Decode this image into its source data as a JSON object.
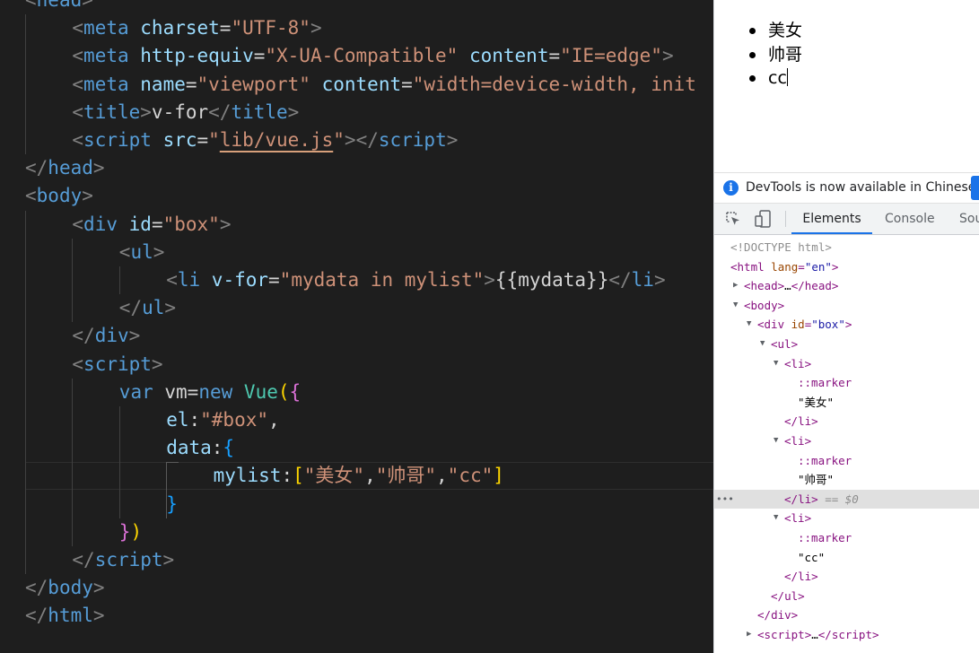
{
  "editor": {
    "lines": [
      {
        "tokens": [
          "<",
          "head",
          ">"
        ]
      },
      {
        "tokens": [
          "<",
          "meta",
          " ",
          "charset",
          "=",
          "\"UTF-8\"",
          ">"
        ]
      },
      {
        "tokens": [
          "<",
          "meta",
          " ",
          "http-equiv",
          "=",
          "\"X-UA-Compatible\"",
          " ",
          "content",
          "=",
          "\"IE=edge\"",
          ">"
        ]
      },
      {
        "tokens": [
          "<",
          "meta",
          " ",
          "name",
          "=",
          "\"viewport\"",
          " ",
          "content",
          "=",
          "\"width=device-width, init"
        ]
      },
      {
        "tokens": [
          "<",
          "title",
          ">",
          "v-for",
          "</",
          "title",
          ">"
        ]
      },
      {
        "tokens": [
          "<",
          "script",
          " ",
          "src",
          "=",
          "\"",
          "lib/vue.js",
          "\"",
          ">",
          "</",
          "script",
          ">"
        ]
      },
      {
        "tokens": [
          "</",
          "head",
          ">"
        ]
      },
      {
        "tokens": [
          "<",
          "body",
          ">"
        ]
      },
      {
        "tokens": [
          "<",
          "div",
          " ",
          "id",
          "=",
          "\"box\"",
          ">"
        ]
      },
      {
        "tokens": [
          "<",
          "ul",
          ">"
        ]
      },
      {
        "tokens": [
          "<",
          "li",
          " ",
          "v-for",
          "=",
          "\"mydata in mylist\"",
          ">",
          "{{mydata}}",
          "</",
          "li",
          ">"
        ]
      },
      {
        "tokens": [
          "</",
          "ul",
          ">"
        ]
      },
      {
        "tokens": [
          "</",
          "div",
          ">"
        ]
      },
      {
        "tokens": [
          "<",
          "script",
          ">"
        ]
      },
      {
        "tokens": [
          "var",
          " vm",
          "=",
          "new",
          " ",
          "Vue",
          "(",
          "{"
        ]
      },
      {
        "tokens": [
          "el",
          ":",
          "\"#box\"",
          ","
        ]
      },
      {
        "tokens": [
          "data",
          ":",
          "{"
        ]
      },
      {
        "tokens": [
          "mylist",
          ":",
          "[",
          "\"美女\"",
          ",",
          "\"帅哥\"",
          ",",
          "\"cc\"",
          "]"
        ]
      },
      {
        "tokens": [
          "}"
        ]
      },
      {
        "tokens": [
          "}",
          ")"
        ]
      },
      {
        "tokens": [
          "</",
          "script",
          ">"
        ]
      },
      {
        "tokens": [
          "</",
          "body",
          ">"
        ]
      },
      {
        "tokens": [
          "</",
          "html",
          ">"
        ]
      }
    ]
  },
  "preview": {
    "items": [
      "美女",
      "帅哥",
      "cc"
    ]
  },
  "devtools": {
    "infobar_text": "DevTools is now available in Chinese!",
    "info_icon": "info-icon",
    "tabs": [
      "Elements",
      "Console",
      "Sou"
    ],
    "active_tab": "Elements",
    "dom": [
      {
        "kind": "comment",
        "text": "<!DOCTYPE html>"
      },
      {
        "kind": "open-attr",
        "tag": "html",
        "attr": "lang",
        "val": "\"en\""
      },
      {
        "kind": "collapsed",
        "tag": "head",
        "ellipsis": "…"
      },
      {
        "kind": "open",
        "tag": "body"
      },
      {
        "kind": "open-attr",
        "tag": "div",
        "attr": "id",
        "val": "\"box\""
      },
      {
        "kind": "open",
        "tag": "ul"
      },
      {
        "kind": "open",
        "tag": "li"
      },
      {
        "kind": "pseudo",
        "text": "::marker"
      },
      {
        "kind": "text",
        "text": "\"美女\""
      },
      {
        "kind": "close",
        "tag": "li"
      },
      {
        "kind": "open",
        "tag": "li"
      },
      {
        "kind": "pseudo",
        "text": "::marker"
      },
      {
        "kind": "text",
        "text": "\"帅哥\""
      },
      {
        "kind": "close-selected",
        "tag": "li",
        "suffix": "== $0"
      },
      {
        "kind": "open",
        "tag": "li"
      },
      {
        "kind": "pseudo",
        "text": "::marker"
      },
      {
        "kind": "text",
        "text": "\"cc\""
      },
      {
        "kind": "close",
        "tag": "li"
      },
      {
        "kind": "close",
        "tag": "ul"
      },
      {
        "kind": "close",
        "tag": "div"
      },
      {
        "kind": "collapsed",
        "tag": "script",
        "ellipsis": "…"
      }
    ],
    "selected_dots": "•••"
  }
}
